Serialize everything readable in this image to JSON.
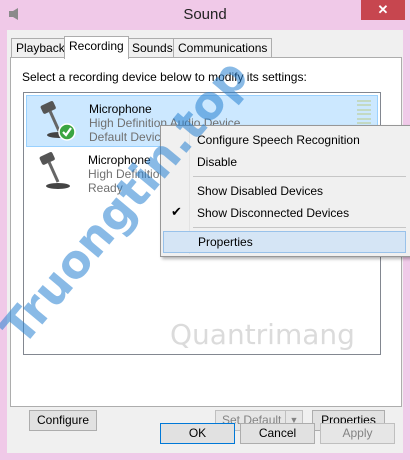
{
  "window": {
    "title": "Sound",
    "close_glyph": "✕"
  },
  "tabs": [
    {
      "label": "Playback"
    },
    {
      "label": "Recording"
    },
    {
      "label": "Sounds"
    },
    {
      "label": "Communications"
    }
  ],
  "recording": {
    "instruction": "Select a recording device below to modify its settings:",
    "devices": [
      {
        "name": "Microphone",
        "driver": "High Definition Audio Device",
        "status": "Default Device",
        "selected": true,
        "icon": "microphone-default-icon"
      },
      {
        "name": "Microphone",
        "driver": "High Definition Audio Device",
        "status": "Ready",
        "selected": false,
        "icon": "microphone-icon"
      }
    ]
  },
  "context_menu": {
    "items": [
      {
        "label": "Configure Speech Recognition"
      },
      {
        "label": "Disable"
      },
      {
        "label": "Show Disabled Devices"
      },
      {
        "label": "Show Disconnected Devices",
        "checked": true
      },
      {
        "label": "Properties"
      }
    ]
  },
  "tab_buttons": {
    "configure": "Configure",
    "set_default": "Set Default",
    "properties": "Properties"
  },
  "dialog_buttons": {
    "ok": "OK",
    "cancel": "Cancel",
    "apply": "Apply"
  },
  "watermarks": {
    "primary": "Truongtin.top",
    "secondary": "Quantrimang"
  },
  "colors": {
    "window_frame": "#f0c9e8",
    "close_button": "#c7464f",
    "selection": "#cce8ff",
    "menu_hover": "#d5e5f5"
  }
}
